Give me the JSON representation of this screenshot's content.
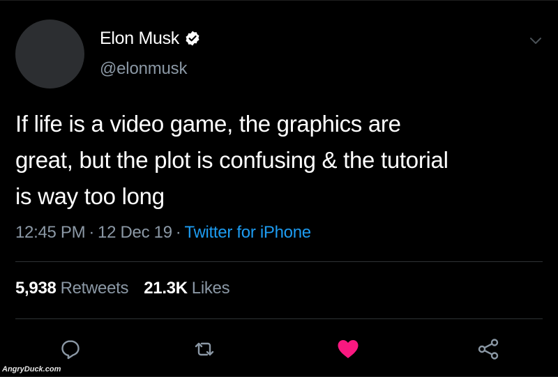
{
  "tweet": {
    "user": {
      "name": "Elon Musk",
      "handle": "@elonmusk",
      "verified": true
    },
    "text_lines": [
      "If life is a video game, the graphics are",
      "great, but the plot is confusing & the tutorial",
      "is way too long"
    ],
    "meta": {
      "time": "12:45 PM",
      "separator": "·",
      "date": "12 Dec 19",
      "source": "Twitter for iPhone"
    },
    "stats": {
      "retweets_count": "5,938",
      "retweets_label": "Retweets",
      "likes_count": "21.3K",
      "likes_label": "Likes"
    },
    "actions": {
      "reply_icon": "reply-icon",
      "retweet_icon": "retweet-icon",
      "like_icon": "heart-icon",
      "share_icon": "share-icon"
    }
  },
  "watermark": "AngryDuck.com",
  "colors": {
    "background": "#000000",
    "text_primary": "#ffffff",
    "text_secondary": "#8b98a5",
    "accent_link": "#1d9bf0",
    "like_active": "#f91880",
    "divider": "#2f3336",
    "avatar_placeholder": "#2c2e31"
  }
}
